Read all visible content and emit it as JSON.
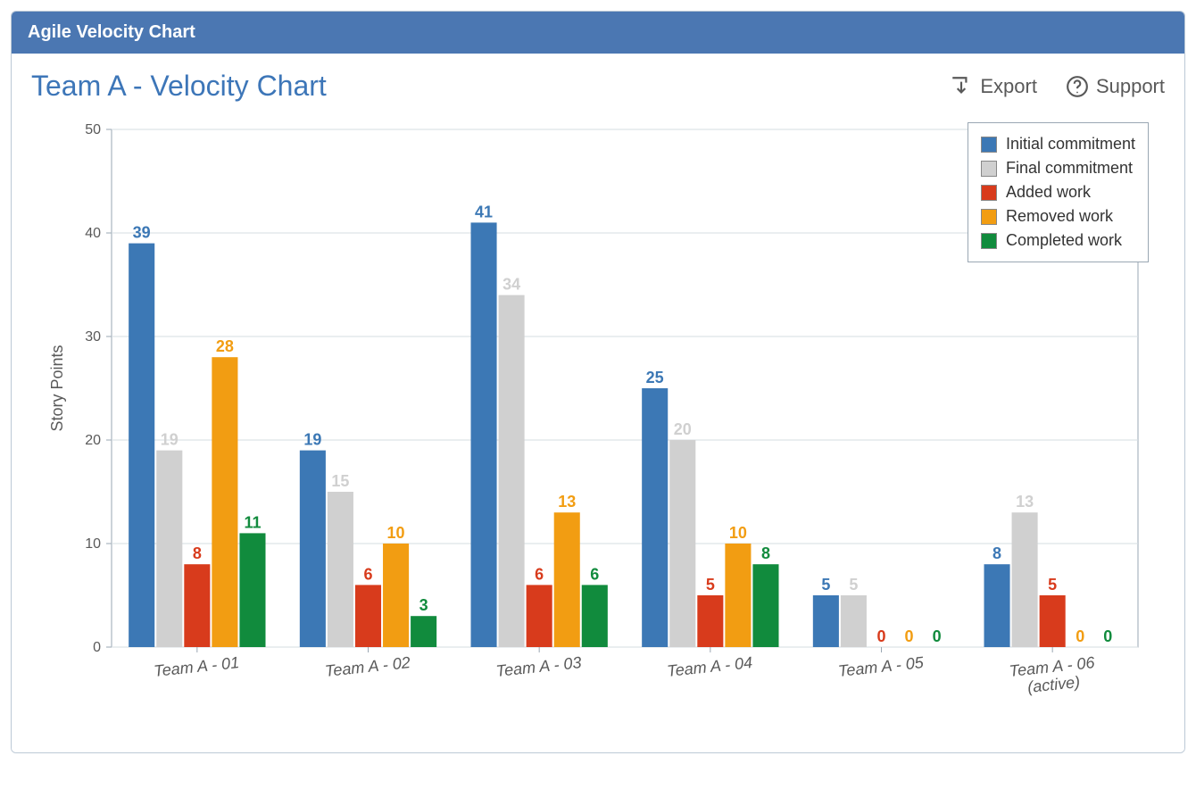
{
  "panel": {
    "title": "Agile Velocity Chart"
  },
  "header": {
    "title": "Team A - Velocity Chart",
    "export_label": "Export",
    "support_label": "Support"
  },
  "chart_data": {
    "type": "bar",
    "ylabel": "Story Points",
    "ylim": [
      0,
      50
    ],
    "yticks": [
      0,
      10,
      20,
      30,
      40,
      50
    ],
    "categories": [
      "Team A - 01",
      "Team A - 02",
      "Team A - 03",
      "Team A - 04",
      "Team A - 05",
      "Team A - 06\n(active)"
    ],
    "series": [
      {
        "name": "Initial commitment",
        "color": "#3c78b5",
        "values": [
          39,
          19,
          41,
          25,
          5,
          8
        ]
      },
      {
        "name": "Final commitment",
        "color": "#d0d0d0",
        "values": [
          19,
          15,
          34,
          20,
          5,
          13
        ]
      },
      {
        "name": "Added work",
        "color": "#d83b1c",
        "values": [
          8,
          6,
          6,
          5,
          0,
          5
        ]
      },
      {
        "name": "Removed work",
        "color": "#f29d12",
        "values": [
          28,
          10,
          13,
          10,
          0,
          0
        ]
      },
      {
        "name": "Completed work",
        "color": "#118b3d",
        "values": [
          11,
          3,
          6,
          8,
          0,
          0
        ]
      }
    ],
    "legend_position": "top-right",
    "grid": true
  }
}
